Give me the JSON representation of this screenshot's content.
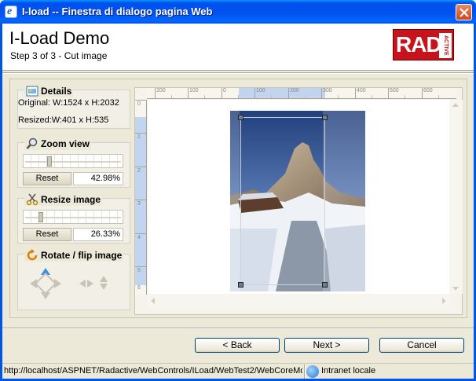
{
  "window": {
    "title": "I-load -- Finestra di dialogo pagina Web"
  },
  "header": {
    "title": "I-Load Demo",
    "subtitle": "Step 3 of 3 - Cut image",
    "logo_text": "RAD",
    "logo_side_text": "ACTIVE"
  },
  "details": {
    "label": "Details",
    "original": "Original: W:1524 x H:2032",
    "resized": "Resized:W:401 x H:535"
  },
  "zoom": {
    "label": "Zoom view",
    "reset_label": "Reset",
    "value": "42.98%",
    "level": 0.43
  },
  "resize": {
    "label": "Resize image",
    "reset_label": "Reset",
    "value": "26.33%",
    "level": 0.26
  },
  "rotate": {
    "label": "Rotate / flip image"
  },
  "ruler": {
    "h_labels": [
      "200",
      "100",
      "0",
      "100",
      "200",
      "300",
      "400",
      "500",
      "600"
    ],
    "v_labels": [
      "0",
      "1",
      "2",
      "3",
      "4",
      "5",
      "6"
    ]
  },
  "buttons": {
    "back": "< Back",
    "next": "Next >",
    "cancel": "Cancel"
  },
  "status": {
    "url": "http://localhost/ASPNET/Radactive/WebControls/ILoad/WebTest2/WebCoreMo",
    "zone": "Intranet locale"
  },
  "colors": {
    "titlebar": "#0055e5",
    "logo": "#c6131c",
    "accent": "#3a8ee6"
  }
}
